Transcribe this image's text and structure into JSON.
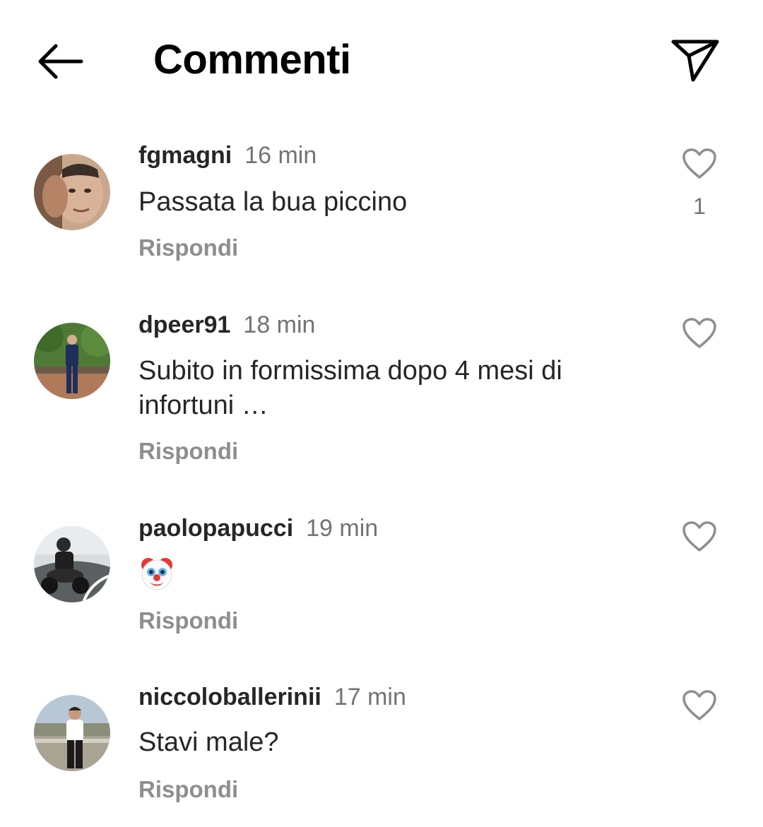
{
  "header": {
    "title": "Commenti",
    "back_icon": "arrow-left-icon",
    "share_icon": "paper-plane-icon"
  },
  "comments": [
    {
      "username": "fgmagni",
      "time": "16 min",
      "text": "Passata la bua piccino",
      "reply_label": "Rispondi",
      "likes": "1"
    },
    {
      "username": "dpeer91",
      "time": "18 min",
      "text": "Subito in formissima dopo 4 mesi di infortuni …",
      "reply_label": "Rispondi"
    },
    {
      "username": "paolopapucci",
      "time": "19 min",
      "text": "",
      "emoji": "clown-face-emoji",
      "reply_label": "Rispondi"
    },
    {
      "username": "niccoloballerinii",
      "time": "17 min",
      "text": "Stavi male?",
      "reply_label": "Rispondi"
    }
  ],
  "colors": {
    "text_primary": "#262626",
    "text_secondary": "#737373",
    "reply": "#8e8e8e"
  }
}
